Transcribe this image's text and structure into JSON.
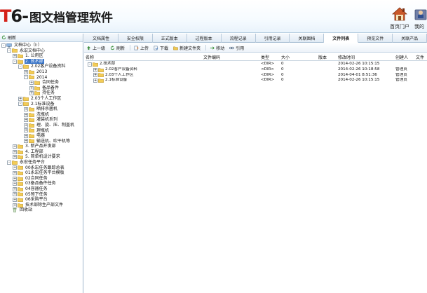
{
  "header": {
    "logo_prefix": "T",
    "logo_digit": "6",
    "logo_dash": "-",
    "logo_title": "图文档管理软件",
    "home_label": "首页门户",
    "mine_label": "我的"
  },
  "left": {
    "refresh_label": "刷新",
    "tree": [
      {
        "label": "文档中心（I:）",
        "level": 0,
        "exp": "-",
        "folder": "computer"
      },
      {
        "label": "永宏文档中心",
        "level": 1,
        "exp": "-",
        "folder": "open"
      },
      {
        "label": "1. 公用区",
        "level": 2,
        "exp": "+",
        "folder": "closed"
      },
      {
        "label": "2. 技术部",
        "level": 2,
        "exp": "-",
        "folder": "open",
        "selected": true
      },
      {
        "label": "2.02客户设备资料",
        "level": 3,
        "exp": "-",
        "folder": "open"
      },
      {
        "label": "2013",
        "level": 4,
        "exp": "+",
        "folder": "closed"
      },
      {
        "label": "2014",
        "level": 4,
        "exp": "-",
        "folder": "open"
      },
      {
        "label": "合同任务",
        "level": 5,
        "exp": "+",
        "folder": "closed"
      },
      {
        "label": "备品备件",
        "level": 5,
        "exp": "+",
        "folder": "closed"
      },
      {
        "label": "持任务",
        "level": 5,
        "exp": "+",
        "folder": "closed"
      },
      {
        "label": "2.03个人工作区",
        "level": 3,
        "exp": "+",
        "folder": "closed"
      },
      {
        "label": "2.1标准设备",
        "level": 3,
        "exp": "-",
        "folder": "open"
      },
      {
        "label": "晒排杀菌机",
        "level": 4,
        "exp": "+",
        "folder": "closed"
      },
      {
        "label": "洗瓶机",
        "level": 4,
        "exp": "+",
        "folder": "closed"
      },
      {
        "label": "灌装机系列",
        "level": 4,
        "exp": "+",
        "folder": "closed"
      },
      {
        "label": "理、旋、压、制盖机",
        "level": 4,
        "exp": "+",
        "folder": "closed"
      },
      {
        "label": "理瓶机",
        "level": 4,
        "exp": "+",
        "folder": "closed"
      },
      {
        "label": "电器",
        "level": 4,
        "exp": "+",
        "folder": "closed"
      },
      {
        "label": "输送机、吹干机等",
        "level": 4,
        "exp": "+",
        "folder": "closed"
      },
      {
        "label": "3. 新产品开发部",
        "level": 2,
        "exp": "+",
        "folder": "closed"
      },
      {
        "label": "4. 工程部",
        "level": 2,
        "exp": "+",
        "folder": "closed"
      },
      {
        "label": "5. 简单机设计要求",
        "level": 2,
        "exp": "+",
        "folder": "closed"
      },
      {
        "label": "永宏任务平台",
        "level": 1,
        "exp": "-",
        "folder": "open"
      },
      {
        "label": "00永宏任务跟踪总表",
        "level": 2,
        "exp": "+",
        "folder": "closed"
      },
      {
        "label": "01永宏任务平台模板",
        "level": 2,
        "exp": "+",
        "folder": "closed"
      },
      {
        "label": "02合同任务",
        "level": 2,
        "exp": "+",
        "folder": "closed"
      },
      {
        "label": "03备品备件任务",
        "level": 2,
        "exp": "+",
        "folder": "closed"
      },
      {
        "label": "04容器任务",
        "level": 2,
        "exp": "+",
        "folder": "closed"
      },
      {
        "label": "05预下任务",
        "level": 2,
        "exp": "+",
        "folder": "closed"
      },
      {
        "label": "06采购平台",
        "level": 2,
        "exp": "+",
        "folder": "closed"
      },
      {
        "label": "技术部除生产部文件",
        "level": 2,
        "exp": "+",
        "folder": "closed"
      },
      {
        "label": "回收站",
        "level": 1,
        "exp": "",
        "folder": "recycle"
      }
    ]
  },
  "tabs": [
    {
      "label": "文档属性"
    },
    {
      "label": "安全权限"
    },
    {
      "label": "正式版本"
    },
    {
      "label": "过程版本"
    },
    {
      "label": "流程记录"
    },
    {
      "label": "引用记录"
    },
    {
      "label": "关联图档"
    },
    {
      "label": "文件列表",
      "active": true
    },
    {
      "label": "预览文件"
    },
    {
      "label": "关联产品"
    }
  ],
  "toolbar": {
    "up": "上一级",
    "refresh": "刷新",
    "upload": "上传",
    "download": "下载",
    "new_folder": "新建文件夹",
    "move": "移动",
    "reference": "引用"
  },
  "grid": {
    "headers": {
      "name": "名称",
      "code": "文件编码",
      "type": "类型",
      "size": "大小",
      "version": "版本",
      "modified": "修改时间",
      "creator": "创建人",
      "file": "文件"
    },
    "root": {
      "name": "2.技术部",
      "type": "<DIR>",
      "size": "0",
      "modified": "2014-02-26 10:15:15",
      "creator": ""
    },
    "rows": [
      {
        "name": "2.02客户设备资料",
        "type": "<DIR>",
        "size": "0",
        "modified": "2014-02-26 10:18:58",
        "creator": "管理员"
      },
      {
        "name": "2.03个人工作区",
        "type": "<DIR>",
        "size": "0",
        "modified": "2014-04-01 8:51:36",
        "creator": "管理员"
      },
      {
        "name": "2.1标准设备",
        "type": "<DIR>",
        "size": "0",
        "modified": "2014-02-26 10:15:15",
        "creator": "管理员"
      }
    ]
  }
}
